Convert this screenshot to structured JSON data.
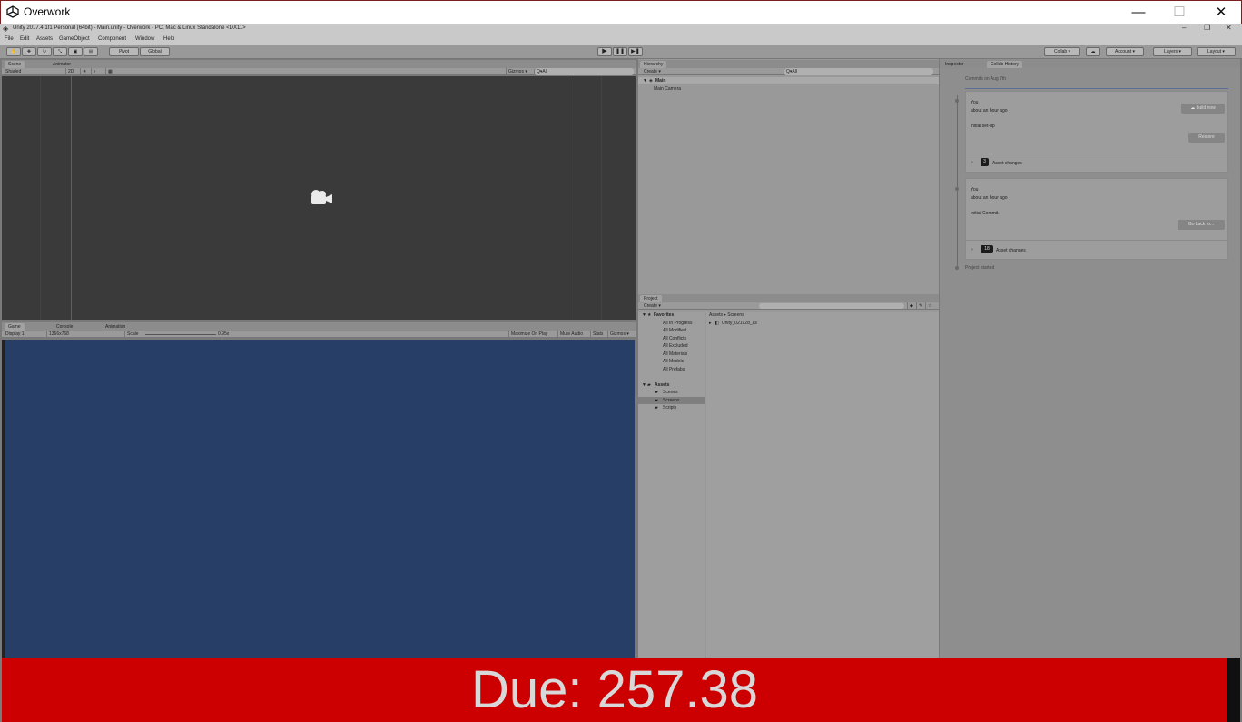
{
  "window": {
    "title": "Overwork",
    "minimize": "—",
    "maximize": "☐",
    "close": "✕"
  },
  "unity": {
    "title": "Unity 2017.4.1f1 Personal (64bit) - Main.unity - Overwork - PC, Mac & Linux Standalone <DX11>",
    "min": "–",
    "restore": "❐",
    "close": "✕"
  },
  "menu": [
    "File",
    "Edit",
    "Assets",
    "GameObject",
    "Component",
    "Window",
    "Help"
  ],
  "toolbar": {
    "pivot": "Pivot",
    "global": "Global",
    "collab": "Collab ▾",
    "account": "Account ▾",
    "layers": "Layers ▾",
    "layout": "Layout ▾"
  },
  "scene": {
    "tabs": [
      "Scene",
      "Animator"
    ],
    "shading": "Shaded",
    "mode2d": "2D",
    "gizmos": "Gizmos ▾",
    "search": "Q▾All"
  },
  "game": {
    "tabs": [
      "Game",
      "Console",
      "Animation"
    ],
    "display": "Display 1",
    "resolution": "1366x768",
    "scale_label": "Scale",
    "scale_value": "0.95x",
    "maximize_on_play": "Maximize On Play",
    "mute_audio": "Mute Audio",
    "stats": "Stats",
    "gizmos": "Gizmos ▾"
  },
  "hierarchy": {
    "tab": "Hierarchy",
    "create": "Create ▾",
    "search": "Q▾All",
    "scene": "Main",
    "items": [
      "Main Camera"
    ]
  },
  "project": {
    "tab": "Project",
    "create": "Create ▾",
    "favorites_label": "Favorites",
    "favorites": [
      "All In Progress",
      "All Modified",
      "All Conflicts",
      "All Excluded",
      "All Materials",
      "All Models",
      "All Prefabs"
    ],
    "assets_label": "Assets",
    "folders": [
      "Scenes",
      "Screens",
      "Scripts"
    ],
    "breadcrumb": "Assets ▸ Screens",
    "files": [
      "Unity_021928_as"
    ]
  },
  "inspector": {
    "tabs": [
      "Inspector",
      "Collab History"
    ],
    "header": "Commits on Aug 7th",
    "commits": [
      {
        "author": "You",
        "time": "about an hour ago",
        "message": "initial set-up",
        "action": "build now",
        "action2": "Restore",
        "count": "3",
        "changes": "Asset changes"
      },
      {
        "author": "You",
        "time": "about an hour ago",
        "message": "Initial Commit.",
        "action": "Go back to...",
        "count": "18",
        "changes": "Asset changes"
      }
    ],
    "footer": "Project started"
  },
  "overlay": {
    "due_text": "Due: 257.38"
  },
  "colors": {
    "due_bg": "#cc0000",
    "game_bg": "#273f66",
    "scene_bg": "#3a3a3a"
  }
}
